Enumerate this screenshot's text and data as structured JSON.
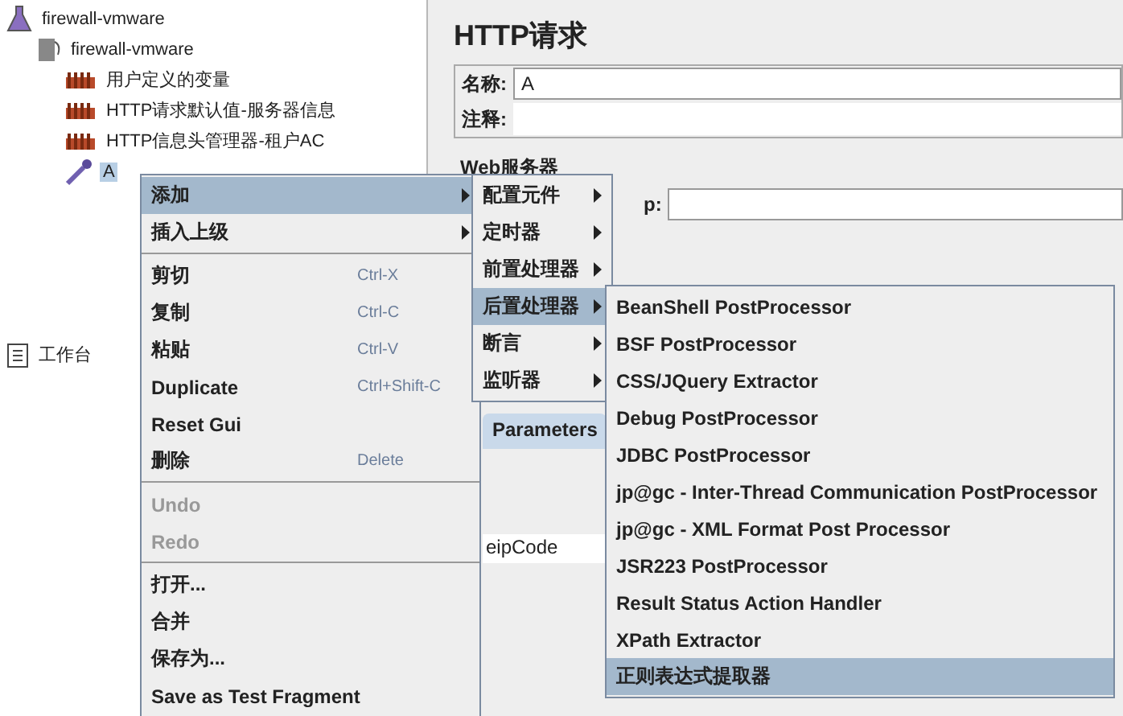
{
  "tree": {
    "items": [
      {
        "label": "firewall-vmware",
        "kind": "plan",
        "selected": false,
        "children": [
          {
            "label": "firewall-vmware",
            "kind": "group",
            "selected": false,
            "children": [
              {
                "label": "用户定义的变量",
                "kind": "config",
                "selected": false
              },
              {
                "label": "HTTP请求默认值-服务器信息",
                "kind": "config",
                "selected": false
              },
              {
                "label": "HTTP信息头管理器-租户AC",
                "kind": "config",
                "selected": false
              },
              {
                "label": "A",
                "kind": "sampler",
                "selected": true
              }
            ]
          }
        ]
      },
      {
        "label": "工作台",
        "kind": "workbench",
        "selected": false
      }
    ]
  },
  "panel": {
    "title": "HTTP请求",
    "name_label": "名称:",
    "name_value": "A",
    "comment_label": "注释:",
    "group_label": "Web服务器",
    "ip_label_part": "p:",
    "tab": "Parameters",
    "param_cell": "eipCode"
  },
  "context_menu": {
    "items": [
      {
        "kind": "submenu",
        "label": "添加",
        "selected": true,
        "disabled": false
      },
      {
        "kind": "submenu",
        "label": "插入上级",
        "selected": false,
        "disabled": false
      },
      {
        "kind": "separator"
      },
      {
        "kind": "item",
        "label": "剪切",
        "shortcut": "Ctrl-X",
        "selected": false,
        "disabled": false
      },
      {
        "kind": "item",
        "label": "复制",
        "shortcut": "Ctrl-C",
        "selected": false,
        "disabled": false
      },
      {
        "kind": "item",
        "label": "粘贴",
        "shortcut": "Ctrl-V",
        "selected": false,
        "disabled": false
      },
      {
        "kind": "item",
        "label": "Duplicate",
        "shortcut": "Ctrl+Shift-C",
        "selected": false,
        "disabled": false
      },
      {
        "kind": "item",
        "label": "Reset Gui",
        "selected": false,
        "disabled": false
      },
      {
        "kind": "item",
        "label": "删除",
        "shortcut": "Delete",
        "selected": false,
        "disabled": false
      },
      {
        "kind": "separator"
      },
      {
        "kind": "item",
        "label": "Undo",
        "selected": false,
        "disabled": true
      },
      {
        "kind": "item",
        "label": "Redo",
        "selected": false,
        "disabled": true
      },
      {
        "kind": "separator"
      },
      {
        "kind": "item",
        "label": "打开...",
        "selected": false,
        "disabled": false
      },
      {
        "kind": "item",
        "label": "合并",
        "selected": false,
        "disabled": false
      },
      {
        "kind": "item",
        "label": "保存为...",
        "selected": false,
        "disabled": false
      },
      {
        "kind": "item",
        "label": "Save as Test Fragment",
        "selected": false,
        "disabled": false
      }
    ]
  },
  "add_menu": {
    "items": [
      {
        "kind": "submenu",
        "label": "配置元件",
        "selected": false,
        "disabled": false
      },
      {
        "kind": "submenu",
        "label": "定时器",
        "selected": false,
        "disabled": false
      },
      {
        "kind": "submenu",
        "label": "前置处理器",
        "selected": false,
        "disabled": false
      },
      {
        "kind": "submenu",
        "label": "后置处理器",
        "selected": true,
        "disabled": false
      },
      {
        "kind": "submenu",
        "label": "断言",
        "selected": false,
        "disabled": false
      },
      {
        "kind": "submenu",
        "label": "监听器",
        "selected": false,
        "disabled": false
      }
    ]
  },
  "post_menu": {
    "items": [
      {
        "kind": "item",
        "label": "BeanShell PostProcessor",
        "selected": false,
        "disabled": false
      },
      {
        "kind": "item",
        "label": "BSF PostProcessor",
        "selected": false,
        "disabled": false
      },
      {
        "kind": "item",
        "label": "CSS/JQuery Extractor",
        "selected": false,
        "disabled": false
      },
      {
        "kind": "item",
        "label": "Debug PostProcessor",
        "selected": false,
        "disabled": false
      },
      {
        "kind": "item",
        "label": "JDBC PostProcessor",
        "selected": false,
        "disabled": false
      },
      {
        "kind": "item",
        "label": "jp@gc - Inter-Thread Communication PostProcessor",
        "selected": false,
        "disabled": false
      },
      {
        "kind": "item",
        "label": "jp@gc - XML Format Post Processor",
        "selected": false,
        "disabled": false
      },
      {
        "kind": "item",
        "label": "JSR223 PostProcessor",
        "selected": false,
        "disabled": false
      },
      {
        "kind": "item",
        "label": "Result Status Action Handler",
        "selected": false,
        "disabled": false
      },
      {
        "kind": "item",
        "label": "XPath Extractor",
        "selected": false,
        "disabled": false
      },
      {
        "kind": "item",
        "label": "正则表达式提取器",
        "selected": true,
        "disabled": false
      }
    ]
  }
}
